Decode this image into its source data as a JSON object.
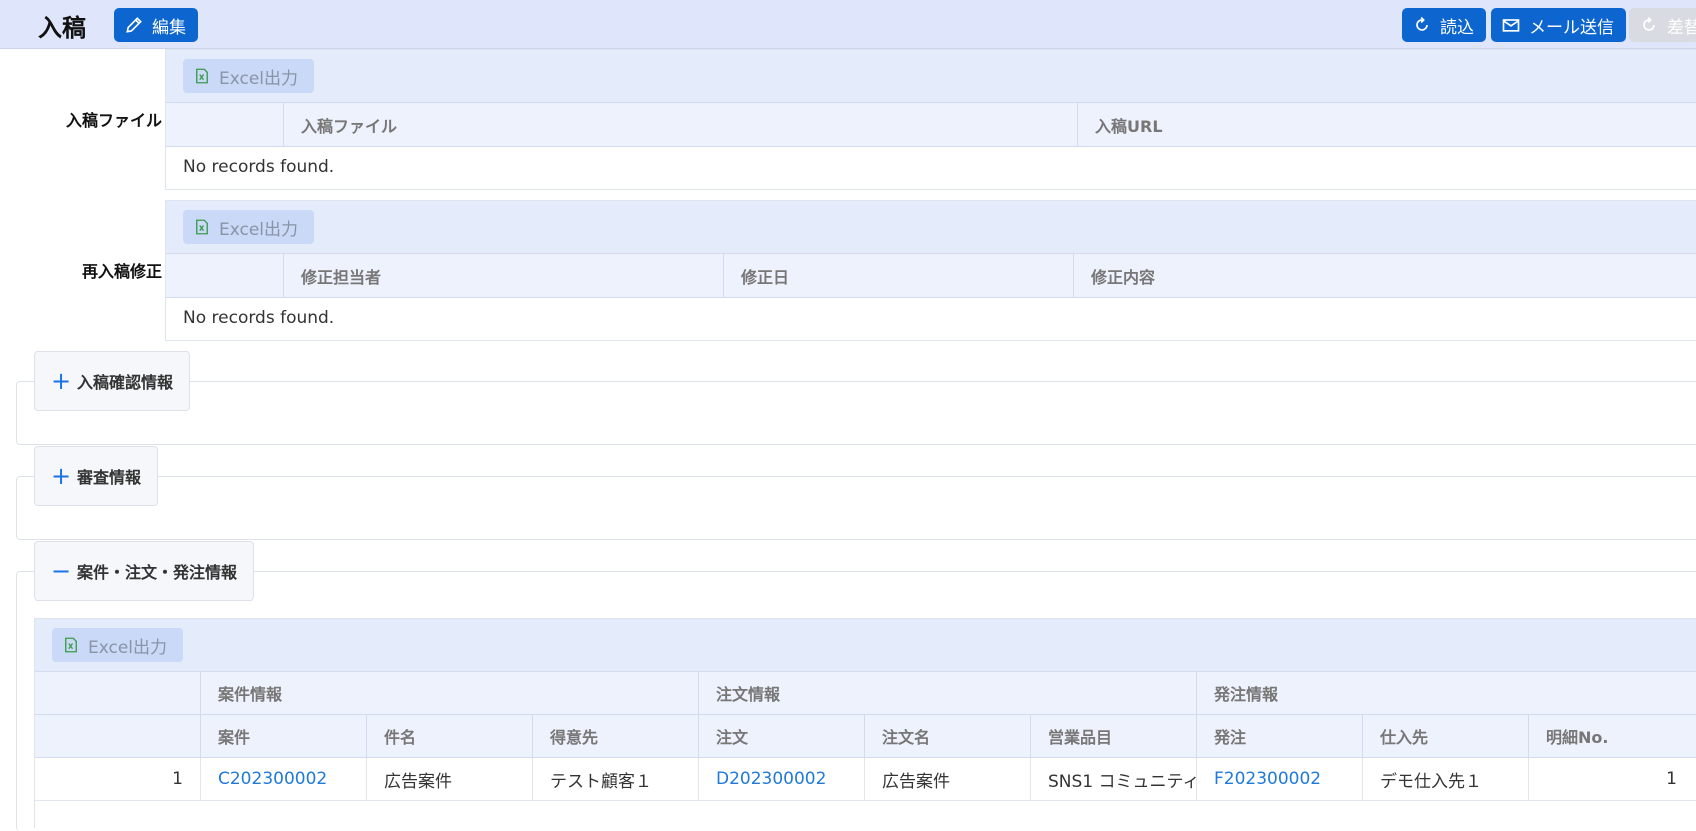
{
  "header": {
    "title": "入稿",
    "edit_label": "編集",
    "reload_label": "読込",
    "mail_label": "メール送信",
    "replace_label": "差替"
  },
  "excel_label": "Excel出力",
  "empty_message": "No records found.",
  "submission_files": {
    "label": "入稿ファイル",
    "columns": [
      "入稿ファイル",
      "入稿URL"
    ]
  },
  "resubmission": {
    "label": "再入稿修正",
    "columns": [
      "修正担当者",
      "修正日",
      "修正内容"
    ]
  },
  "sections": {
    "confirm": {
      "label": "入稿確認情報",
      "state": "collapsed"
    },
    "review": {
      "label": "審査情報",
      "state": "collapsed"
    },
    "case_order": {
      "label": "案件・注文・発注情報",
      "state": "expanded"
    }
  },
  "case_table": {
    "groups": [
      "案件情報",
      "注文情報",
      "発注情報"
    ],
    "columns": [
      "案件",
      "件名",
      "得意先",
      "注文",
      "注文名",
      "営業品目",
      "発注",
      "仕入先",
      "明細No."
    ],
    "rows": [
      {
        "index": "1",
        "case_no": "C202300002",
        "subject": "広告案件",
        "customer": "テスト顧客１",
        "order_no": "D202300002",
        "order_name": "広告案件",
        "sales_item": "SNS1 コミュニティ",
        "purchase_no": "F202300002",
        "supplier": "デモ仕入先１",
        "detail_no": "1"
      }
    ]
  },
  "colors": {
    "primary": "#0d66d0",
    "header_bg": "#dfe6fb",
    "link": "#1f7ad8"
  }
}
